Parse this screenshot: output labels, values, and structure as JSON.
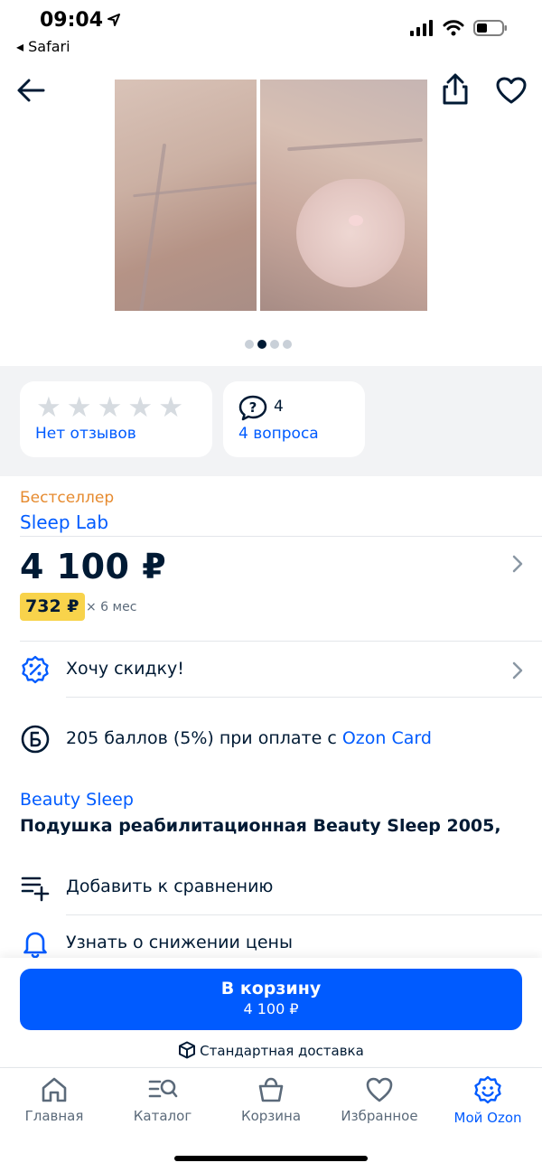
{
  "status_bar": {
    "time": "09:04",
    "back_app": "◂ Safari"
  },
  "header": {
    "back_icon": "arrow-left-icon",
    "share_icon": "share-icon",
    "favorite_icon": "heart-icon"
  },
  "gallery": {
    "dots_total": 4,
    "active_dot": 2
  },
  "reviews_card": {
    "stars_total": 5,
    "stars_filled": 0,
    "link": "Нет отзывов"
  },
  "questions_card": {
    "count": "4",
    "link": "4 вопроса"
  },
  "product": {
    "badge": "Бестселлер",
    "seller": "Sleep Lab",
    "price": "4 100 ₽",
    "installment_amount": "732 ₽",
    "installment_term": "× 6 мес",
    "brand": "Beauty Sleep",
    "title": "Подушка реабилитационная Beauty Sleep 2005,"
  },
  "rows": {
    "discount": "Хочу скидку!",
    "bonus_text": "205 баллов (5%) при оплате с ",
    "bonus_link": "Ozon Card",
    "compare": "Добавить к сравнению",
    "price_alert": "Узнать о снижении цены"
  },
  "cart": {
    "label": "В корзину",
    "price": "4 100 ₽",
    "delivery": "Стандартная доставка"
  },
  "tabbar": {
    "tabs": [
      {
        "label": "Главная",
        "icon": "home-icon"
      },
      {
        "label": "Каталог",
        "icon": "catalog-icon"
      },
      {
        "label": "Корзина",
        "icon": "cart-icon"
      },
      {
        "label": "Избранное",
        "icon": "heart-icon"
      },
      {
        "label": "Мой Ozon",
        "icon": "profile-smile-icon",
        "active": true
      }
    ]
  },
  "colors": {
    "accent": "#005bff",
    "text": "#001a34",
    "badge_orange": "#e68a2e",
    "installment_yellow": "#f8d34b"
  }
}
